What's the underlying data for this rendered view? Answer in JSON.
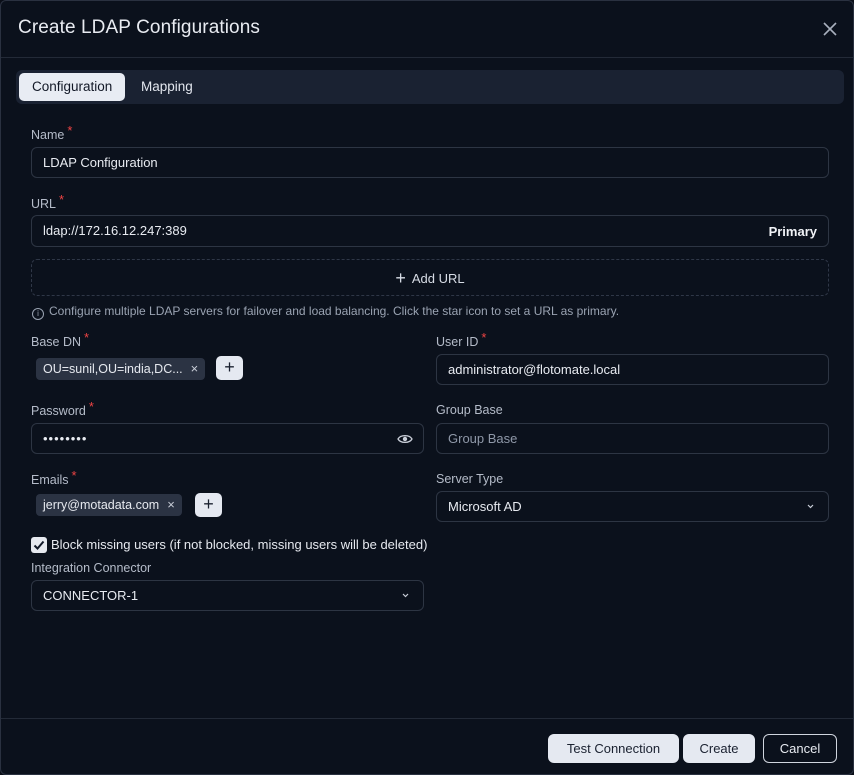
{
  "modal": {
    "title": "Create LDAP Configurations"
  },
  "tabs": [
    {
      "label": "Configuration",
      "active": true
    },
    {
      "label": "Mapping",
      "active": false
    }
  ],
  "form": {
    "name": {
      "label": "Name",
      "value": "LDAP Configuration"
    },
    "url": {
      "label": "URL",
      "value": "ldap://172.16.12.247:389",
      "badge": "Primary"
    },
    "add_url_label": "Add URL",
    "hint": "Configure multiple LDAP servers for failover and load balancing. Click the star icon to set a URL as primary.",
    "base_dn": {
      "label": "Base DN",
      "chips": [
        "OU=sunil,OU=india,DC..."
      ]
    },
    "user_id": {
      "label": "User ID",
      "value": "administrator@flotomate.local"
    },
    "password": {
      "label": "Password",
      "value": "••••••••"
    },
    "group_base": {
      "label": "Group Base",
      "placeholder": "Group Base"
    },
    "emails": {
      "label": "Emails",
      "chips": [
        "jerry@motadata.com"
      ]
    },
    "server_type": {
      "label": "Server Type",
      "value": "Microsoft AD"
    },
    "block_missing": {
      "label": "Block missing users (if not blocked, missing users will be deleted)",
      "checked": true
    },
    "connector": {
      "label": "Integration Connector",
      "value": "CONNECTOR-1"
    }
  },
  "footer": {
    "test_label": "Test Connection",
    "create_label": "Create",
    "cancel_label": "Cancel"
  }
}
